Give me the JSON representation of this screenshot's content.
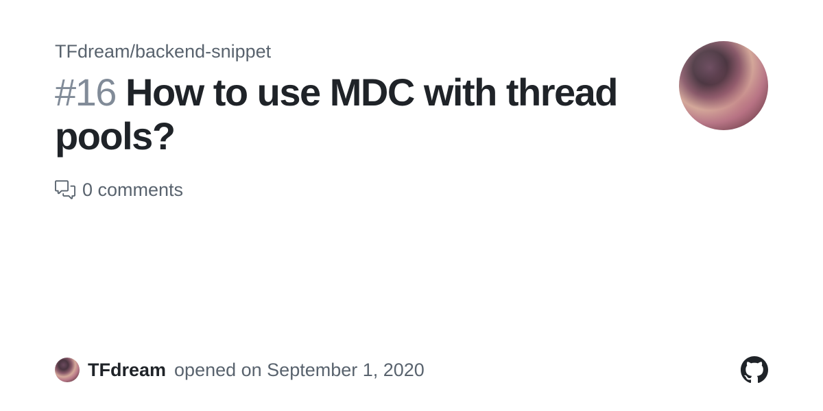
{
  "repo": {
    "path": "TFdream/backend-snippet"
  },
  "issue": {
    "number": "#16",
    "title": "How to use MDC with thread pools?",
    "comments_count": "0 comments"
  },
  "meta": {
    "username": "TFdream",
    "opened_text": "opened on September 1, 2020"
  }
}
